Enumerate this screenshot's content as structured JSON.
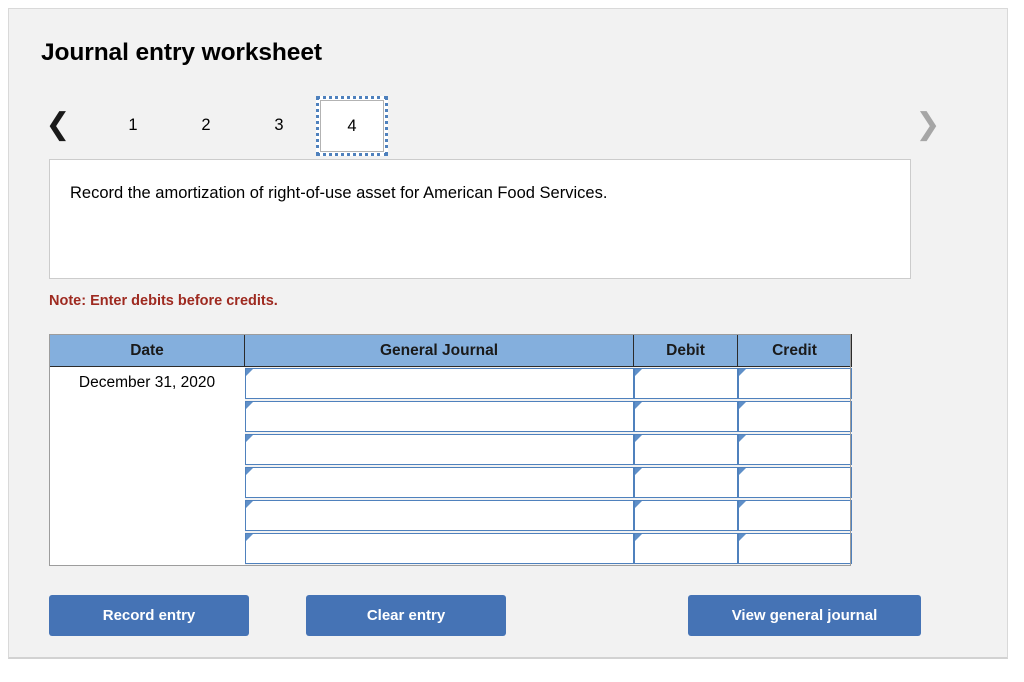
{
  "header": {
    "title": "Journal entry worksheet"
  },
  "pager": {
    "prev_icon": "chevron-left-icon",
    "next_icon": "chevron-right-icon",
    "tabs": [
      {
        "label": "1",
        "selected": false
      },
      {
        "label": "2",
        "selected": false
      },
      {
        "label": "3",
        "selected": false
      },
      {
        "label": "4",
        "selected": true
      }
    ],
    "selected_tab": "4"
  },
  "instruction": {
    "text": "Record the amortization of right-of-use asset for American Food Services."
  },
  "note": {
    "text": "Note: Enter debits before credits.",
    "color": "#9e2a20"
  },
  "table": {
    "columns": [
      "Date",
      "General Journal",
      "Debit",
      "Credit"
    ],
    "rows": [
      {
        "date": "December 31, 2020",
        "general_journal": "",
        "debit": "",
        "credit": ""
      },
      {
        "date": "",
        "general_journal": "",
        "debit": "",
        "credit": ""
      },
      {
        "date": "",
        "general_journal": "",
        "debit": "",
        "credit": ""
      },
      {
        "date": "",
        "general_journal": "",
        "debit": "",
        "credit": ""
      },
      {
        "date": "",
        "general_journal": "",
        "debit": "",
        "credit": ""
      },
      {
        "date": "",
        "general_journal": "",
        "debit": "",
        "credit": ""
      }
    ],
    "header_color": "#84afdd",
    "input_border_color": "#4f81bd"
  },
  "actions": {
    "record_label": "Record entry",
    "clear_label": "Clear entry",
    "view_label": "View general journal",
    "button_color": "#4573b5"
  }
}
